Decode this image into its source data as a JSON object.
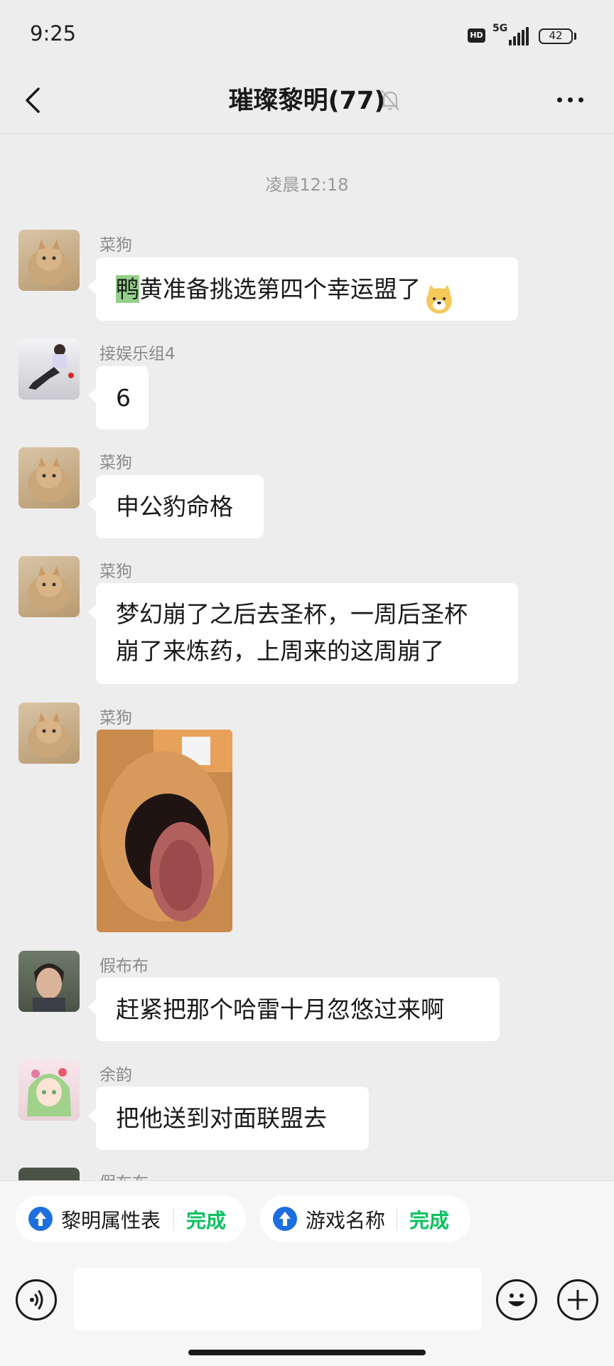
{
  "status_bar": {
    "time": "9:25",
    "hd": "HD",
    "network": "5G",
    "battery": "42"
  },
  "header": {
    "title": "璀璨黎明(77)"
  },
  "chat": {
    "timestamp": "凌晨12:18",
    "messages": [
      {
        "sender": "菜狗",
        "text_highlight": "鸭",
        "text_rest": "黄准备挑选第四个幸运盟了",
        "emoji": "dog-face-emoji"
      },
      {
        "sender": "接娱乐组4",
        "text": "6"
      },
      {
        "sender": "菜狗",
        "text": "申公豹命格"
      },
      {
        "sender": "菜狗",
        "line1": "梦幻崩了之后去圣杯，一周后圣杯",
        "line2": "崩了来炼药，上周来的这周崩了"
      },
      {
        "sender": "菜狗",
        "image": "dog-nose-sticker"
      },
      {
        "sender": "假布布",
        "text": "赶紧把那个哈雷十月忽悠过来啊"
      },
      {
        "sender": "余韵",
        "text": "把他送到对面联盟去"
      },
      {
        "sender": "假布布"
      }
    ]
  },
  "chips": [
    {
      "label": "黎明属性表",
      "action": "完成"
    },
    {
      "label": "游戏名称",
      "action": "完成"
    }
  ],
  "input": {
    "value": ""
  },
  "colors": {
    "accent_green": "#07c160",
    "chip_icon_blue": "#1d6fe0",
    "bubble": "#ffffff",
    "background": "#ededed"
  }
}
